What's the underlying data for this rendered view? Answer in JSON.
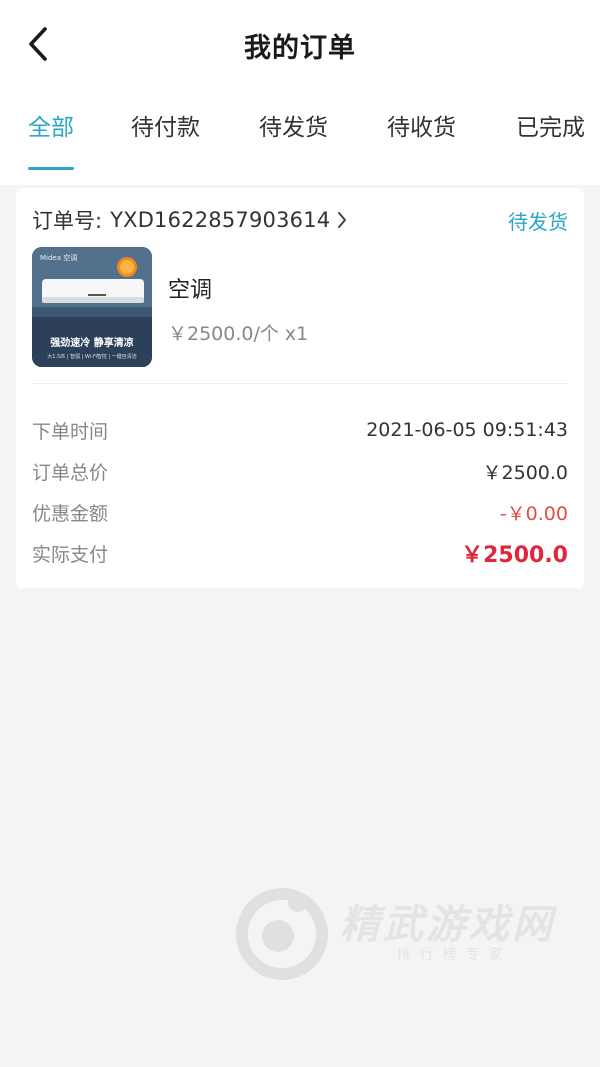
{
  "header": {
    "title": "我的订单"
  },
  "tabs": [
    {
      "label": "全部",
      "active": true
    },
    {
      "label": "待付款",
      "active": false
    },
    {
      "label": "待发货",
      "active": false
    },
    {
      "label": "待收货",
      "active": false
    },
    {
      "label": "已完成",
      "active": false
    }
  ],
  "order": {
    "order_no_label": "订单号:",
    "order_no": "YXD1622857903614",
    "status": "待发货",
    "product": {
      "name": "空调",
      "price_line": "￥2500.0/个 x1",
      "image_brand": "Midea 空调",
      "image_slogan": "强劲速冷 静享清凉",
      "image_specs": "大1.5匹 | 智弧 | Wi-Fi智控 | 一键自清洁"
    },
    "details": [
      {
        "label": "下单时间",
        "value": "2021-06-05 09:51:43"
      },
      {
        "label": "订单总价",
        "value": "￥2500.0"
      },
      {
        "label": "优惠金额",
        "value": "-￥0.00"
      },
      {
        "label": "实际支付",
        "value": "￥2500.0"
      }
    ]
  },
  "watermark": {
    "title": "精武游戏网",
    "subtitle": "排行榜专家"
  },
  "colors": {
    "accent": "#2aa6c4",
    "discount": "#e44a4a",
    "paid": "#e0263a"
  },
  "icons": {
    "back": "chevron-left-icon",
    "order_link": "chevron-right-icon"
  }
}
